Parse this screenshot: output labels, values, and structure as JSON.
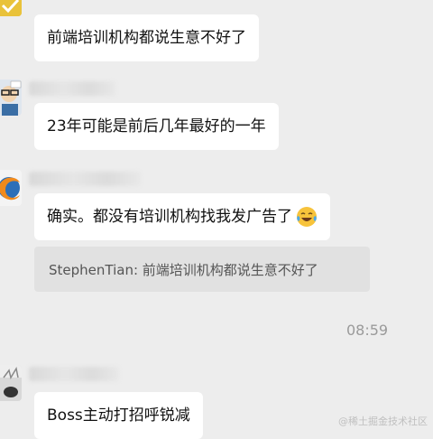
{
  "messages": [
    {
      "text": "前端培训机构都说生意不好了"
    },
    {
      "text": "23年可能是前后几年最好的一年"
    },
    {
      "text": "确实。都没有培训机构找我发广告了",
      "emoji": "tears-of-joy-emoji",
      "quote": "StephenTian: 前端培训机构都说生意不好了"
    },
    {
      "text": "Boss主动打招呼锐减"
    }
  ],
  "timestamp": "08:59",
  "watermark": "@稀土掘金技术社区",
  "colors": {
    "background": "#ededed",
    "bubble": "#ffffff",
    "quote_bg": "#e1e1e1",
    "timestamp": "#9a9a9a"
  }
}
